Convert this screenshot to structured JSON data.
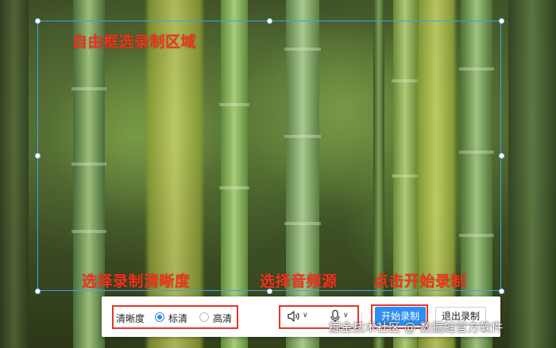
{
  "annotations": {
    "free_select": "自由框选录制区域",
    "select_quality": "选择录制清晰度",
    "select_audio": "选择音频源",
    "click_start": "点击开始录制"
  },
  "toolbar": {
    "quality_label": "清晰度",
    "quality_options": [
      {
        "label": "标清",
        "selected": true
      },
      {
        "label": "高清",
        "selected": false
      }
    ],
    "speaker_icon": "speaker-icon",
    "mic_icon": "microphone-icon",
    "start_label": "开始录制",
    "exit_label": "退出录制"
  },
  "watermark": "掘金技术社区 @ 数据蛙官方软件",
  "colors": {
    "frame": "#39a3e6",
    "annotation": "#f3311c",
    "primary": "#2f8ff0",
    "highlight_box": "#e5352a"
  }
}
